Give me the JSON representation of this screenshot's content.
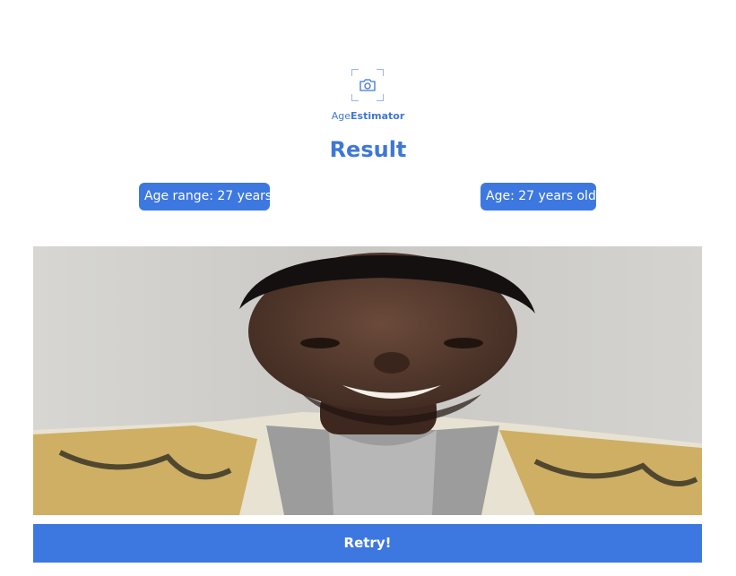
{
  "app": {
    "logo_icon": "camera-icon",
    "brand_prefix": "Age",
    "brand_suffix": "Estimator",
    "accent_color": "#3d78e0"
  },
  "result": {
    "title": "Result",
    "age_range_label": "Age range: 27 years",
    "age_label": "Age: 27 years old"
  },
  "photo": {
    "alt": "Uploaded face photo"
  },
  "actions": {
    "retry_label": "Retry!"
  }
}
